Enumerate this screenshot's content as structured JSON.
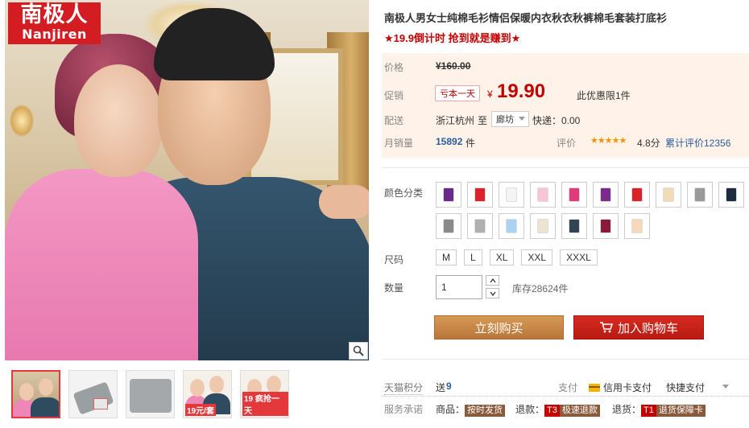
{
  "brand": {
    "name_cn": "南极人",
    "name_en": "Nanjiren"
  },
  "product": {
    "title": "南极人男女士纯棉毛衫情侣保暖内衣秋衣秋裤棉毛套装打底衫",
    "promo": "★19.9倒计时 抢到就是赚到★"
  },
  "price": {
    "label": "价格",
    "original": "¥160.00",
    "promo_label": "促销",
    "promo_tag": "亏本一天",
    "currency": "¥",
    "promo_price": "19.90",
    "limit_note": "此优惠限1件"
  },
  "delivery": {
    "label": "配送",
    "from": "浙江杭州",
    "to_word": "至",
    "destination": "廊坊",
    "shipping": "快递：0.00"
  },
  "sales": {
    "label": "月销量",
    "count": "15892",
    "unit": "件",
    "rating_label": "评价",
    "stars": "★★★★★",
    "rating": "4.8分",
    "reviews": "累计评价12356"
  },
  "colors": {
    "label": "颜色分类",
    "swatches": [
      "#6a2a8a",
      "#d8232a",
      "#f4f4f4",
      "#f7c6d6",
      "#e23a7a",
      "#7a2a8a",
      "#d8232a",
      "#f2dcb8",
      "#9a9a9a",
      "#1e2a40",
      "#8a8a8a",
      "#b0b0b0",
      "#a9d3f0",
      "#ece4d0",
      "#324454",
      "#8a1a3a",
      "#f6d9b8"
    ]
  },
  "sizes": {
    "label": "尺码",
    "options": [
      "M",
      "L",
      "XL",
      "XXL",
      "XXXL"
    ]
  },
  "quantity": {
    "label": "数量",
    "value": "1",
    "stock": "库存28624件"
  },
  "actions": {
    "buy": "立刻购买",
    "cart": "加入购物车"
  },
  "points": {
    "label": "天猫积分",
    "value_prefix": "送",
    "value": "9"
  },
  "payment": {
    "label": "支付",
    "method": "信用卡支付",
    "quick": "快捷支付"
  },
  "service": {
    "label": "服务承诺",
    "item1_label": "商品：",
    "item1_badge": "按时发货",
    "item2_label": "退款：",
    "item2_code": "T3",
    "item2_badge": "极速退款",
    "item3_label": "退货：",
    "item3_code": "T1",
    "item3_badge": "退货保障卡"
  },
  "thumbs": {
    "badge1": "19元/套",
    "badge2": "19 疯抢一天"
  },
  "icons": [
    "zoom-icon",
    "cart-icon",
    "credit-card-icon",
    "dropdown-arrow-icon",
    "chevron-up-icon",
    "chevron-down-icon"
  ]
}
